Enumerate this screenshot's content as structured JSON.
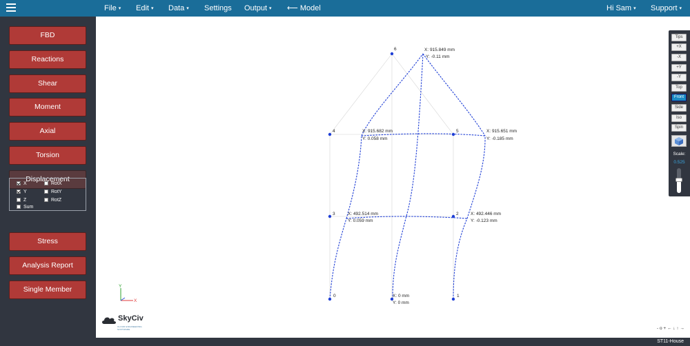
{
  "topbar": {
    "menus": [
      {
        "label": "File",
        "caret": "▾"
      },
      {
        "label": "Edit",
        "caret": "▾"
      },
      {
        "label": "Data",
        "caret": "▾"
      },
      {
        "label": "Settings",
        "caret": ""
      },
      {
        "label": "Output",
        "caret": "▾"
      },
      {
        "label": "⟵ Model",
        "caret": ""
      }
    ],
    "user": {
      "label": "Hi Sam",
      "caret": "▾"
    },
    "support": {
      "label": "Support",
      "caret": "▾"
    }
  },
  "sidebar": {
    "buttons": [
      "FBD",
      "Reactions",
      "Shear",
      "Moment",
      "Axial",
      "Torsion",
      "Displacement"
    ],
    "active": "Displacement",
    "displacement_options": [
      {
        "label": "X",
        "checked": true
      },
      {
        "label": "RotX",
        "checked": false
      },
      {
        "label": "Y",
        "checked": true
      },
      {
        "label": "RotY",
        "checked": false
      },
      {
        "label": "Z",
        "checked": false
      },
      {
        "label": "RotZ",
        "checked": false
      },
      {
        "label": "Sum",
        "checked": false
      }
    ],
    "lower_buttons": [
      "Stress",
      "Analysis Report",
      "Single Member"
    ]
  },
  "view_panel": {
    "buttons": [
      "Tips",
      "+X",
      "-X",
      "+Y",
      "-Y",
      "Top",
      "Front",
      "Side",
      "Iso",
      "Spin"
    ],
    "active": "Front",
    "scale_label": "Scale:",
    "scale_value": "0.525",
    "scale_fraction": 0.525
  },
  "model": {
    "nodes": [
      {
        "id": "0"
      },
      {
        "id": "1"
      },
      {
        "id": "2"
      },
      {
        "id": "3"
      },
      {
        "id": "4"
      },
      {
        "id": "5"
      },
      {
        "id": "6"
      }
    ],
    "annotations": [
      {
        "x": "X: 915.849 mm",
        "y": "Y: -0.11 mm"
      },
      {
        "x": "X: 915.682 mm",
        "y": "Y: 0.058 mm"
      },
      {
        "x": "X: 915.651 mm",
        "y": "Y: -0.185 mm"
      },
      {
        "x": "X: 492.514 mm",
        "y": "Y: 0.059 mm"
      },
      {
        "x": "X: 492.446 mm",
        "y": "Y: -0.123 mm"
      },
      {
        "x": "X: 0 mm",
        "y": "Y: 0 mm"
      }
    ],
    "axis_labels": {
      "y": "Y",
      "x": "X"
    }
  },
  "logo": {
    "name": "SkyCiv",
    "tagline": "CLOUD ENGINEERING SOFTWARE"
  },
  "nav_arrows": "- o + ← ↓ ↑ →",
  "footer": {
    "model_name": "ST11-House"
  },
  "colors": {
    "topbar": "#1a6d99",
    "sidebar": "#313640",
    "button": "#b03a37",
    "deflected": "#1f3fd6",
    "node": "#1f3fd6"
  }
}
